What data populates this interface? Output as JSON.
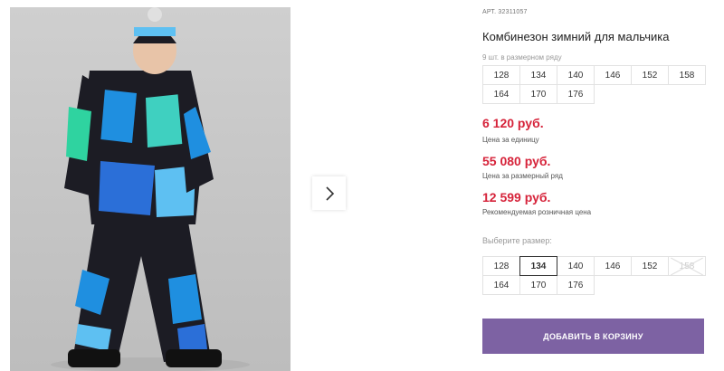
{
  "product": {
    "article": "АРТ. 32311057",
    "title": "Комбинезон зимний для мальчика",
    "row_note": "9 шт. в размерном ряду",
    "row_sizes": [
      "128",
      "134",
      "140",
      "146",
      "152",
      "158",
      "164",
      "170",
      "176"
    ]
  },
  "prices": {
    "unit_price": "6 120 руб.",
    "unit_label": "Цена за единицу",
    "row_price": "55 080 руб.",
    "row_label": "Цена за размерный ряд",
    "retail_price": "12 599 руб.",
    "retail_label": "Рекомендуемая розничная цена"
  },
  "selector": {
    "label": "Выберите размер:",
    "sizes": [
      {
        "value": "128",
        "state": "available"
      },
      {
        "value": "134",
        "state": "selected"
      },
      {
        "value": "140",
        "state": "available"
      },
      {
        "value": "146",
        "state": "available"
      },
      {
        "value": "152",
        "state": "available"
      },
      {
        "value": "158",
        "state": "unavailable"
      },
      {
        "value": "164",
        "state": "available"
      },
      {
        "value": "170",
        "state": "available"
      },
      {
        "value": "176",
        "state": "available"
      }
    ]
  },
  "cart_button": "ДОБАВИТЬ В КОРЗИНУ",
  "gallery": {
    "next_icon": "chevron-right-icon"
  },
  "colors": {
    "accent": "#7d62a3",
    "price": "#d6233a"
  }
}
